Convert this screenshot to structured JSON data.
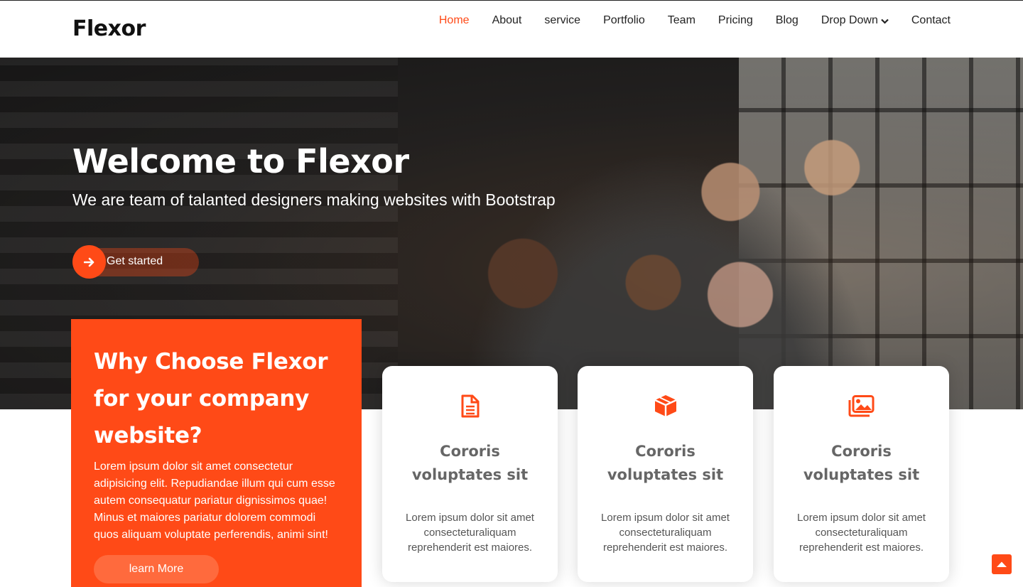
{
  "brand": {
    "logo": "Flexor"
  },
  "nav": {
    "items": [
      {
        "label": "Home",
        "active": true
      },
      {
        "label": "About"
      },
      {
        "label": "service"
      },
      {
        "label": "Portfolio"
      },
      {
        "label": "Team"
      },
      {
        "label": "Pricing"
      },
      {
        "label": "Blog"
      },
      {
        "label": "Drop Down",
        "has_dropdown": true
      },
      {
        "label": "Contact"
      }
    ]
  },
  "hero": {
    "title": "Welcome to Flexor",
    "subtitle": "We are team of talanted designers making websites with Bootstrap",
    "cta_label": "Get started",
    "cta_icon": "arrow-right-icon"
  },
  "why": {
    "title_line1": "Why Choose Flexor",
    "title_line2": "for your company",
    "title_line3": "website?",
    "body": "Lorem ipsum dolor sit amet consectetur adipisicing elit. Repudiandae illum qui cum esse autem consequatur pariatur dignissimos quae! Minus et maiores pariatur dolorem commodi quos aliquam voluptate perferendis, animi sint!",
    "button_label": "learn More"
  },
  "cards": [
    {
      "icon": "document-icon",
      "title": "Cororis voluptates sit",
      "text": "Lorem ipsum dolor sit amet consecteturaliquam reprehenderit est maiores."
    },
    {
      "icon": "cube-icon",
      "title": "Cororis voluptates sit",
      "text": "Lorem ipsum dolor sit amet consecteturaliquam reprehenderit est maiores."
    },
    {
      "icon": "images-icon",
      "title": "Cororis voluptates sit",
      "text": "Lorem ipsum dolor sit amet consecteturaliquam reprehenderit est maiores."
    }
  ],
  "colors": {
    "accent": "#ff4a17",
    "text": "#222222",
    "card_title": "#666666"
  },
  "back_to_top_icon": "caret-up-icon"
}
